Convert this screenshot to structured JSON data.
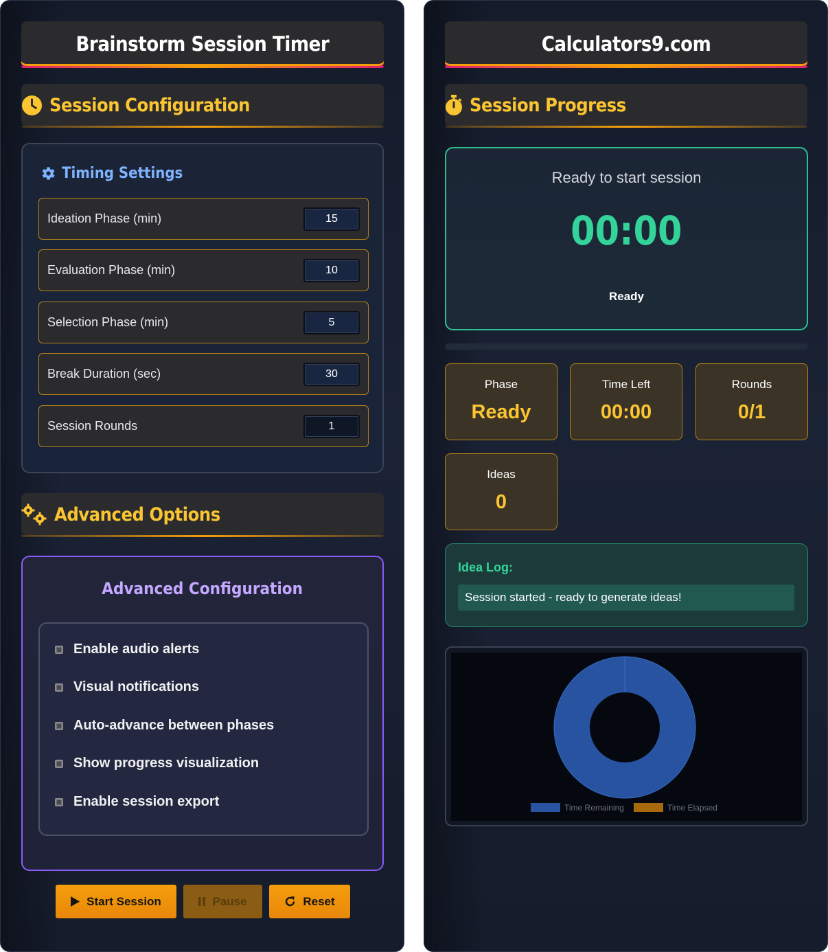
{
  "left": {
    "title": "Brainstorm Session Timer",
    "config_heading": "Session Configuration",
    "timing_heading": "Timing Settings",
    "fields": [
      {
        "label": "Ideation Phase (min)",
        "value": "15"
      },
      {
        "label": "Evaluation Phase (min)",
        "value": "10"
      },
      {
        "label": "Selection Phase (min)",
        "value": "5"
      },
      {
        "label": "Break Duration (sec)",
        "value": "30"
      },
      {
        "label": "Session Rounds",
        "value": "1"
      }
    ],
    "advanced_heading": "Advanced Options",
    "advanced_title": "Advanced Configuration",
    "options": [
      {
        "label": "Enable audio alerts",
        "checked": false
      },
      {
        "label": "Visual notifications",
        "checked": false
      },
      {
        "label": "Auto-advance between phases",
        "checked": false
      },
      {
        "label": "Show progress visualization",
        "checked": false
      },
      {
        "label": "Enable session export",
        "checked": false
      }
    ],
    "buttons": {
      "start": "Start Session",
      "pause": "Pause",
      "reset": "Reset"
    }
  },
  "right": {
    "title": "Calculators9.com",
    "progress_heading": "Session Progress",
    "timer": {
      "status": "Ready to start session",
      "clock": "00:00",
      "phase": "Ready"
    },
    "progress_percent": 0,
    "stats": {
      "phase": {
        "label": "Phase",
        "value": "Ready"
      },
      "time_left": {
        "label": "Time Left",
        "value": "00:00"
      },
      "rounds": {
        "label": "Rounds",
        "value": "0/1"
      },
      "ideas": {
        "label": "Ideas",
        "value": "0"
      }
    },
    "idea_log": {
      "title": "Idea Log:",
      "entries": [
        "Session started - ready to generate ideas!"
      ]
    }
  },
  "chart_data": {
    "type": "pie",
    "categories": [
      "Time Remaining",
      "Time Elapsed"
    ],
    "values": [
      100,
      0
    ],
    "colors": [
      "#2753a0",
      "#a8690d"
    ],
    "legend": "bottom"
  },
  "colors": {
    "accent": "#fbc531",
    "amber": "#f59e0b",
    "magenta": "#e11d74",
    "green": "#34d399",
    "purple": "#8b5cf6",
    "blue_label": "#7fb2ff"
  }
}
